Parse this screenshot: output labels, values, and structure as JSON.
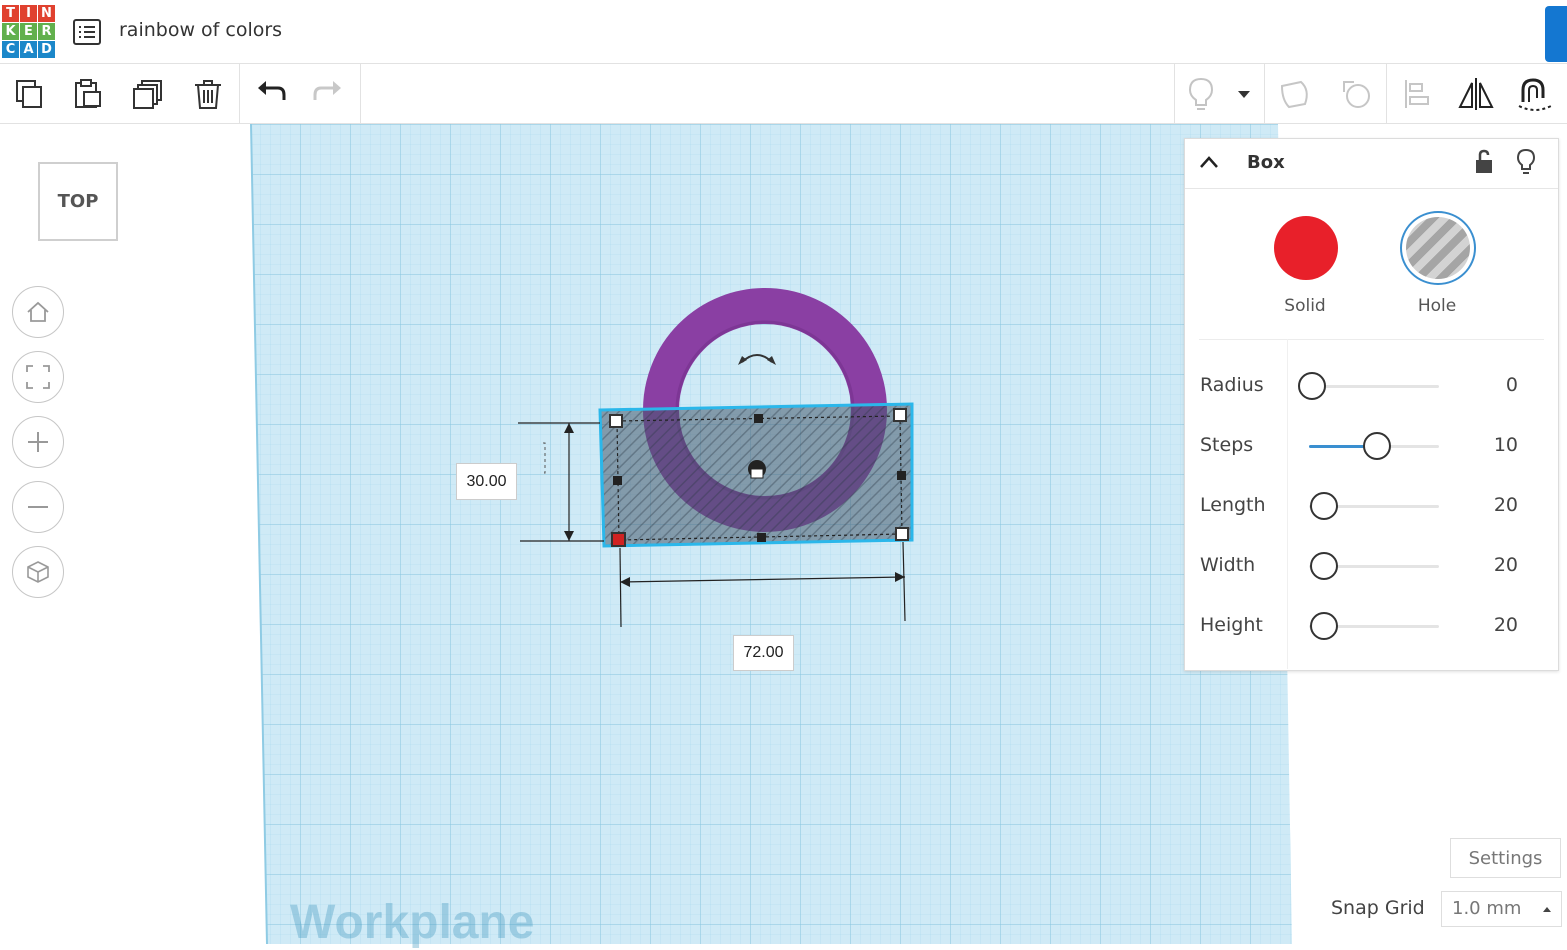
{
  "app": {
    "logo_letters": [
      "T",
      "I",
      "N",
      "K",
      "E",
      "R",
      "C",
      "A",
      "D"
    ],
    "logo_colors": [
      "#e0412f",
      "#e0412f",
      "#e0412f",
      "#62b04d",
      "#62b04d",
      "#62b04d",
      "#1b87c9",
      "#1b87c9",
      "#1b87c9"
    ],
    "design_title": "rainbow of colors"
  },
  "toolbar": {
    "buttons": [
      "copy",
      "paste",
      "duplicate",
      "delete",
      "undo",
      "redo"
    ],
    "right_buttons": [
      "show-all",
      "dropdown",
      "group",
      "ungroup",
      "align",
      "mirror",
      "cruise"
    ]
  },
  "view": {
    "cube_face": "TOP",
    "nav_buttons": [
      "home-icon",
      "fit-icon",
      "zoom-in-icon",
      "zoom-out-icon",
      "perspective-icon"
    ]
  },
  "workplane": {
    "label": "Workplane",
    "dimension_height": "30.00",
    "dimension_width": "72.00",
    "ring_color": "#8a3fa3",
    "grid_color": "#bfe4f2"
  },
  "inspector": {
    "shape_name": "Box",
    "solid_label": "Solid",
    "hole_label": "Hole",
    "solid_color": "#e8202a",
    "properties": [
      {
        "label": "Radius",
        "value": "0",
        "fraction": 0.0
      },
      {
        "label": "Steps",
        "value": "10",
        "fraction": 0.5
      },
      {
        "label": "Length",
        "value": "20",
        "fraction": 0.0
      },
      {
        "label": "Width",
        "value": "20",
        "fraction": 0.0
      },
      {
        "label": "Height",
        "value": "20",
        "fraction": 0.0
      }
    ]
  },
  "footer": {
    "settings_label": "Settings",
    "snap_label": "Snap Grid",
    "snap_value": "1.0 mm"
  }
}
